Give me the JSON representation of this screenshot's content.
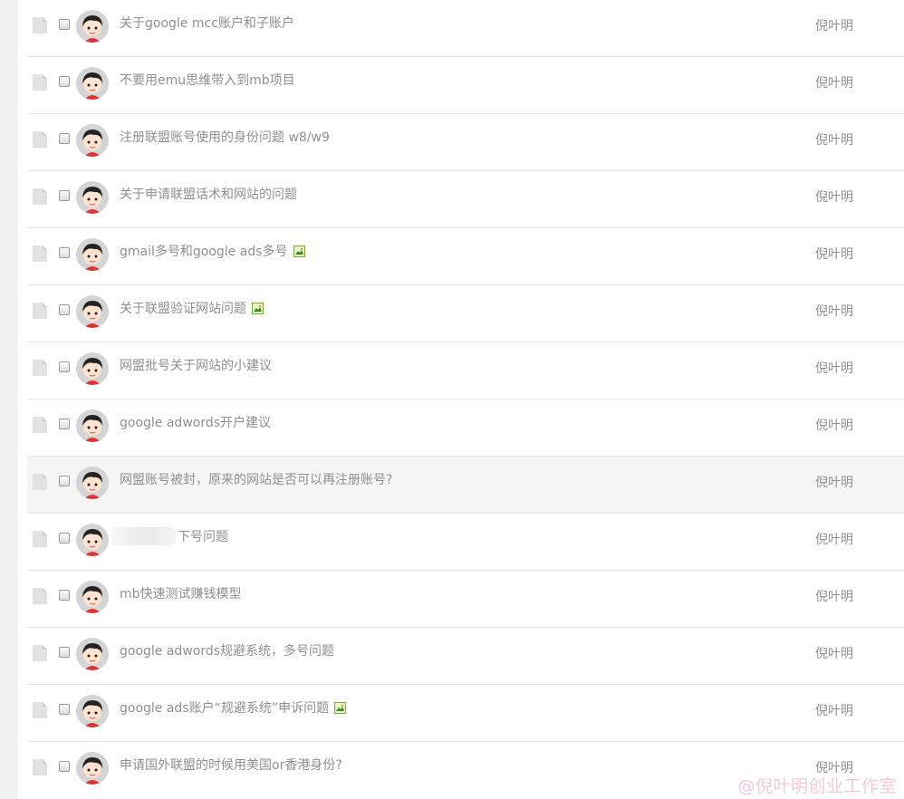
{
  "threads": [
    {
      "title": "关于google mcc账户和子账户",
      "author": "倪叶明",
      "has_image": false
    },
    {
      "title": "不要用emu思维带入到mb项目",
      "author": "倪叶明",
      "has_image": false
    },
    {
      "title": "注册联盟账号使用的身份问题 w8/w9",
      "author": "倪叶明",
      "has_image": false
    },
    {
      "title": "关于申请联盟话术和网站的问题",
      "author": "倪叶明",
      "has_image": false
    },
    {
      "title": "gmail多号和google ads多号",
      "author": "倪叶明",
      "has_image": true
    },
    {
      "title": "关于联盟验证网站问题",
      "author": "倪叶明",
      "has_image": true
    },
    {
      "title": "网盟批号关于网站的小建议",
      "author": "倪叶明",
      "has_image": false
    },
    {
      "title": "google adwords开户建议",
      "author": "倪叶明",
      "has_image": false
    },
    {
      "title": "网盟账号被封，原来的网站是否可以再注册账号?",
      "author": "倪叶明",
      "has_image": false
    },
    {
      "title": "下号问题",
      "author": "倪叶明",
      "has_image": false
    },
    {
      "title": "mb快速测试赚钱模型",
      "author": "倪叶明",
      "has_image": false
    },
    {
      "title": "google adwords规避系统，多号问题",
      "author": "倪叶明",
      "has_image": false
    },
    {
      "title": "google ads账户“规避系统”申诉问题",
      "author": "倪叶明",
      "has_image": true
    },
    {
      "title": "申请国外联盟的时候用美国or香港身份?",
      "author": "倪叶明",
      "has_image": false
    }
  ],
  "watermark": "@倪叶明创业工作室",
  "colors": {
    "row_highlight": "#f5f5f5",
    "divider": "#e6e6e6",
    "text": "#8f8f8f"
  }
}
